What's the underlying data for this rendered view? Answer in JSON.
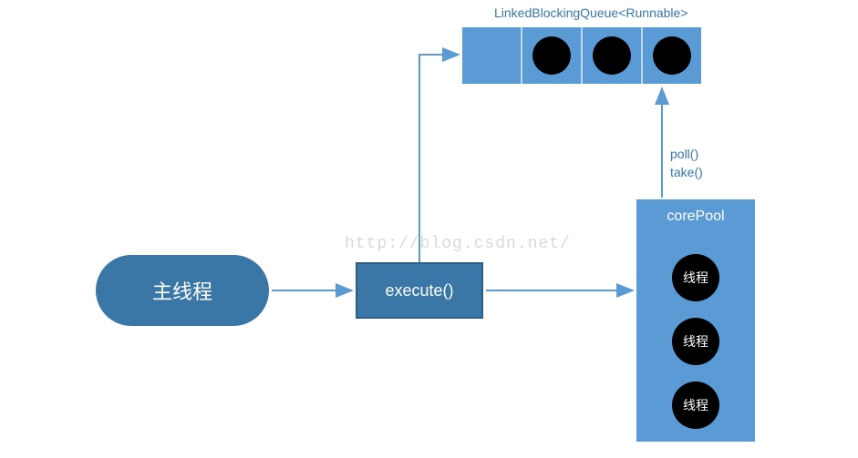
{
  "watermark": "http://blog.csdn.net/",
  "mainThread": {
    "label": "主线程"
  },
  "execute": {
    "label": "execute()"
  },
  "queue": {
    "title": "LinkedBlockingQueue<Runnable>",
    "cells": [
      "",
      "task",
      "task",
      "task"
    ]
  },
  "arrowLabels": {
    "pollTakeLine1": "poll()",
    "pollTakeLine2": "take()"
  },
  "corePool": {
    "title": "corePool",
    "threads": [
      "线程",
      "线程",
      "线程"
    ]
  },
  "colors": {
    "darkBlue": "#3a77a6",
    "lightBlue": "#5b9bd5",
    "arrow": "#5b9bd5"
  }
}
